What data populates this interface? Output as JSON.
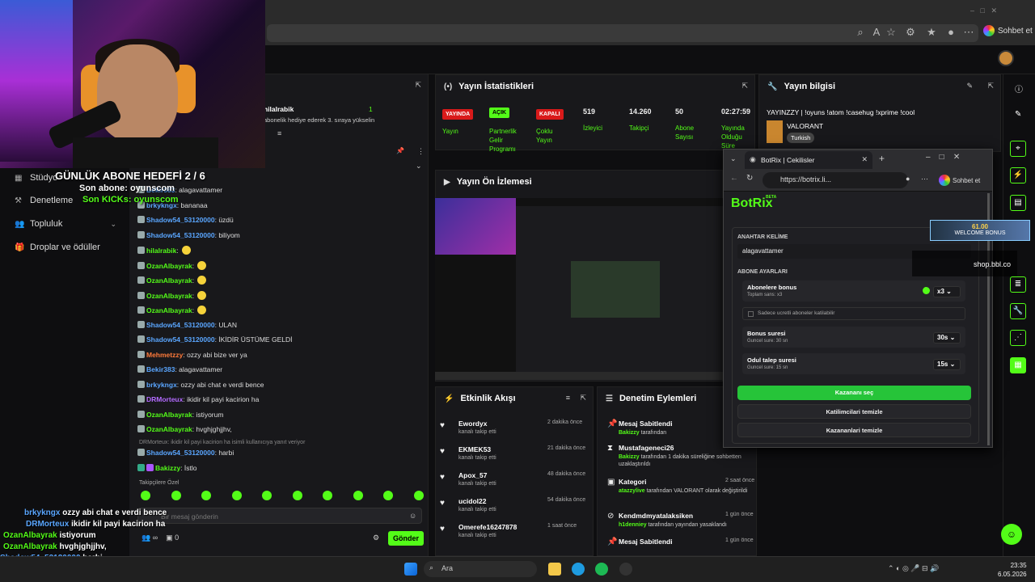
{
  "browser": {
    "sohbet_label": "Sohbet et"
  },
  "nav": {
    "items": [
      "Stüdyo",
      "Denetleme",
      "Topluluk",
      "Droplar ve ödüller"
    ]
  },
  "overlay": {
    "goal": "GÜNLÜK ABONE HEDEFİ 2 / 6",
    "last_sub": "Son abone: oyunscom",
    "last_kicks": "Son KICKs: oyunscom",
    "chat": [
      {
        "user": "brkykngx",
        "text": "ozzy abi chat e verdi bence"
      },
      {
        "user": "DRMorteux",
        "text": "ikidir kil payi kacirion ha"
      },
      {
        "user": "OzanAlbayrak",
        "text": "istiyorum"
      },
      {
        "user": "OzanAlbayrak",
        "text": "hvghjghjjhv,"
      },
      {
        "user": "Shadow54_53120000",
        "text": "harbi"
      },
      {
        "user": "Bakizzy",
        "text": "İstlo"
      }
    ],
    "shop": "shop.bbl.co",
    "bonus_amount": "61.00",
    "bonus_label": "WELCOME BONUS"
  },
  "chat": {
    "pinned_user": "hilalrabik",
    "pinned_count": "1",
    "pinned_text": "abonelik hediye ederek 3. sıraya yükselin",
    "lines": [
      {
        "user": "Bekir383",
        "text": "alagavattamer",
        "color": "#5aa6ff"
      },
      {
        "user": "brkykngx",
        "text": "bananaa",
        "color": "#5aa6ff"
      },
      {
        "user": "Shadow54_53120000",
        "text": "üzdü",
        "color": "#5aa6ff"
      },
      {
        "user": "Shadow54_53120000",
        "text": "biliyom",
        "color": "#5aa6ff"
      },
      {
        "user": "hilalrabik",
        "text": "",
        "color": "#53fc18"
      },
      {
        "user": "OzanAlbayrak",
        "text": "",
        "color": "#53fc18"
      },
      {
        "user": "OzanAlbayrak",
        "text": "",
        "color": "#53fc18"
      },
      {
        "user": "OzanAlbayrak",
        "text": "",
        "color": "#53fc18"
      },
      {
        "user": "OzanAlbayrak",
        "text": "",
        "color": "#53fc18"
      },
      {
        "user": "Shadow54_53120000",
        "text": "ULAN",
        "color": "#5aa6ff"
      },
      {
        "user": "Shadow54_53120000",
        "text": "İKİDİR ÜSTÜME GELDİ",
        "color": "#5aa6ff"
      },
      {
        "user": "Mehmetzzy",
        "text": "ozzy abi bize ver ya",
        "color": "#ff7a3a"
      },
      {
        "user": "Bekir383",
        "text": "alagavattamer",
        "color": "#5aa6ff"
      },
      {
        "user": "brkykngx",
        "text": "ozzy abi chat e verdi bence",
        "color": "#5aa6ff"
      },
      {
        "user": "DRMorteux",
        "text": "ikidir kil payi kacirion ha",
        "color": "#b36bff"
      },
      {
        "user": "OzanAlbayrak",
        "text": "istiyorum",
        "color": "#53fc18"
      },
      {
        "user": "OzanAlbayrak",
        "text": "hvghjghjjhv,",
        "color": "#53fc18"
      }
    ],
    "reply_note": "DRMorteux: ikidir kil payi kacirion ha isimli kullanıcıya yanıt veriyor",
    "reply_line": {
      "user": "Shadow54_53120000",
      "text": "harbi"
    },
    "last_line": {
      "user": "Bakizzy",
      "text": "İstlo"
    },
    "followers_only": "Takipçilere Özel",
    "input_placeholder": "Bir mesaj gönderin",
    "points": "0",
    "send_label": "Gönder"
  },
  "stats": {
    "title": "Yayın İstatistikleri",
    "badges": [
      {
        "badge": "YAYINDA",
        "label": "Yayın",
        "color": "#d91a1a"
      },
      {
        "badge": "AÇIK",
        "label": "Partnerlik Gelir Programı",
        "color": "#53fc18"
      },
      {
        "badge": "KAPALI",
        "label": "Çoklu Yayın",
        "color": "#d91a1a"
      }
    ],
    "values": [
      {
        "value": "519",
        "label": "İzleyici"
      },
      {
        "value": "14.260",
        "label": "Takipçi"
      },
      {
        "value": "50",
        "label": "Abone Sayısı"
      },
      {
        "value": "02:27:59",
        "label": "Yayında Olduğu Süre"
      }
    ]
  },
  "info": {
    "title": "Yayın bilgisi",
    "stream_title": "YAYINZZY | !oyuns !atom !casehug !xprime !cool",
    "category": "VALORANT",
    "language": "Turkish"
  },
  "preview": {
    "title": "Yayın Ön İzlemesi"
  },
  "activity": {
    "title": "Etkinlik Akışı",
    "items": [
      {
        "name": "Ewordyx",
        "sub": "kanalı takip etti",
        "time": "2 dakika önce"
      },
      {
        "name": "EKMEK53",
        "sub": "kanalı takip etti",
        "time": "21 dakika önce"
      },
      {
        "name": "Apox_57",
        "sub": "kanalı takip etti",
        "time": "48 dakika önce"
      },
      {
        "name": "ucidol22",
        "sub": "kanalı takip etti",
        "time": "54 dakika önce"
      },
      {
        "name": "Omerefe16247878",
        "sub": "kanalı takip etti",
        "time": "1 saat önce"
      }
    ]
  },
  "moderation": {
    "title": "Denetim Eylemleri",
    "items": [
      {
        "name": "Mesaj Sabitlendi",
        "actor": "Bakizzy",
        "desc": "tarafından",
        "time": "2"
      },
      {
        "name": "Mustafageneci26",
        "actor": "Bakizzy",
        "desc": "tarafından 1 dakika süreliğine sohbetten uzaklaştırıldı",
        "time": "2"
      },
      {
        "name": "Kategori",
        "actor": "atazzylive",
        "desc": "tarafından VALORANT olarak değiştirildi",
        "time": "2 saat önce"
      },
      {
        "name": "Kendmdmyatalaksiken",
        "actor": "h1denniey",
        "desc": "tarafından yayından yasaklandı",
        "time": "1 gün önce"
      },
      {
        "name": "Mesaj Sabitlendi",
        "actor": "",
        "desc": "",
        "time": "1 gün önce"
      }
    ]
  },
  "botrix": {
    "tab_title": "BotRix | Cekilisler",
    "url": "https://botrix.li...",
    "sohbet_label": "Sohbet et",
    "logo": "BotRix",
    "beta": "BETA",
    "keyword_section": "ANAHTAR KELİME",
    "keyword": "alagavattamer",
    "sub_section": "ABONE AYARLARI",
    "sub_bonus": "Abonelere bonus",
    "sub_bonus_sub": "Toplam sans: x3",
    "sub_bonus_val": "x3",
    "only_free": "Sadece ucretli aboneler katilabilir",
    "bonus_time": "Bonus suresi",
    "bonus_time_sub": "Guncel sure: 30 sn",
    "bonus_time_val": "30s",
    "claim_time": "Odul talep suresi",
    "claim_time_sub": "Guncel sure: 15 sn",
    "claim_time_val": "15s",
    "pick_btn": "Kazananı seç",
    "clear_participants": "Katilimcilari temizle",
    "clear_winners": "Kazananlari temizle"
  },
  "taskbar": {
    "search": "Ara",
    "time": "23:35",
    "date": "6.05.2026"
  },
  "colors": {
    "accent": "#53fc18",
    "panel": "#18181b",
    "bg": "#0e0e10"
  }
}
